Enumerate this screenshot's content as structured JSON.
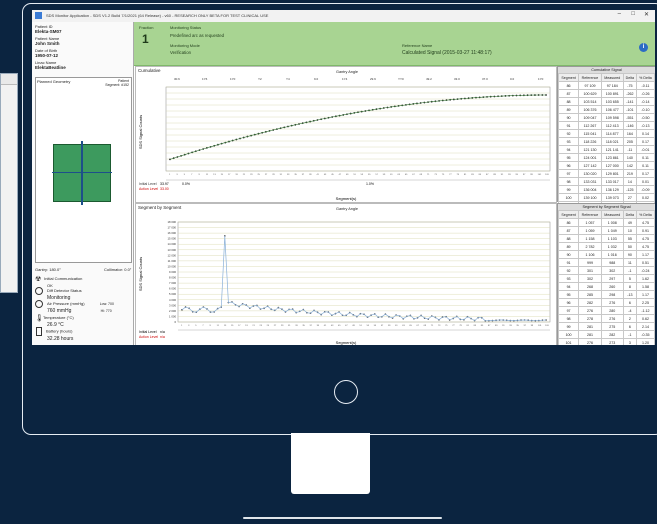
{
  "window": {
    "title": "SDS Monitor Application - SDS V1.2 Build 7/1/2021 (64 Release) - v60 - RESEARCH ONLY BETA FOR TEST CLINICAL USE",
    "min": "–",
    "max": "□",
    "close": "✕"
  },
  "patient": {
    "id_label": "Patient ID",
    "id_value": "Elekta-SM07",
    "name_label": "Patient Name",
    "name_value": "John Smith",
    "dob_label": "Date of Birth",
    "dob_value": "1950-07-12",
    "linac_label": "Linac Name",
    "linac_value": "ElektaBeatline"
  },
  "plan": {
    "title": "Planned Geometry",
    "segment_label": "Patient",
    "segment_value": "Segment: #152"
  },
  "footer": {
    "gantry": "Gantry: 180.0°",
    "collimator": "Collimator: 0.0°",
    "dose_label": "Initial Communication",
    "dose_value": "OK",
    "detector_label": "Diff Detector Status",
    "detector_value": "Monitoring",
    "pressure_label": "Air Pressure (mmHg)",
    "pressure_value": "760 mmHg",
    "temp_label": "Temperature (°C)",
    "temp_value": "26.9 °C",
    "battery_label": "Battery (hours)",
    "battery_value": "32.28 hours",
    "range1": "Low: 700",
    "range2": "Hi: 770"
  },
  "status": {
    "fraction_label": "Fraction",
    "fraction_value": "1",
    "s1_label": "Monitoring Status",
    "s1_value": "Predefined arc as requested",
    "s2_label": "Monitoring Mode",
    "s2_value": "Verification",
    "s3_label": "Reference Name",
    "s3_value": "Calculated Signal (2015-03-27 11:48:17)",
    "info": "i"
  },
  "cumulative": {
    "title": "Cumulative",
    "top_axis": "Gantry Angle",
    "ylabel": "SDS Signal Counts",
    "xlabel": "Segment(s)",
    "ticks_top": [
      "30.6",
      "1Y6",
      "1Y0",
      "Y2",
      "Y4",
      "9.0",
      "1Y4",
      "29.9",
      "YY0",
      "49.2",
      "33.0",
      "37.0",
      "0.0",
      "1Y0"
    ],
    "row1_label": "Initial Level",
    "row1_val": "33.97",
    "row2_label": "Action Level",
    "row2_val": "33.00",
    "row1_pct": "0.0%",
    "row2_pct": "1.0%"
  },
  "sbs": {
    "title": "Segment by Segment",
    "top_axis": "Gantry Angle",
    "ylabel": "SDS Signal Counts",
    "xlabel": "Segment(s)",
    "yticks": [
      "18 000",
      "17 000",
      "16 000",
      "15 000",
      "14 000",
      "13 000",
      "12 000",
      "11 000",
      "10 000",
      "9 000",
      "8 000",
      "7 000",
      "6 000",
      "5 000",
      "4 000",
      "3 000",
      "2 000",
      "1 000",
      "0"
    ],
    "row1_label": "Initial Level",
    "row1_val": "n/a",
    "row2_label": "Action Level",
    "row2_val": "n/a"
  },
  "cum_table": {
    "title": "Cumulative Signal",
    "headers": [
      "Segment",
      "Reference",
      "Measured",
      "Delta",
      "% Delta"
    ],
    "rows": [
      [
        "86",
        "97 109",
        "97 184",
        "-75",
        "-0.11"
      ],
      [
        "87",
        "100 629",
        "100 891",
        "-262",
        "-0.26"
      ],
      [
        "88",
        "103 514",
        "103 655",
        "-141",
        "-0.14"
      ],
      [
        "89",
        "106 376",
        "106 477",
        "-101",
        "-0.10"
      ],
      [
        "90",
        "109 047",
        "109 598",
        "-551",
        "-0.50"
      ],
      [
        "91",
        "112 267",
        "112 413",
        "-146",
        "-0.13"
      ],
      [
        "92",
        "115 041",
        "114 877",
        "164",
        "0.14"
      ],
      [
        "93",
        "118 226",
        "118 021",
        "205",
        "0.17"
      ],
      [
        "94",
        "121 130",
        "121 141",
        "-11",
        "-0.01"
      ],
      [
        "95",
        "124 001",
        "123 861",
        "140",
        "0.11"
      ],
      [
        "96",
        "127 142",
        "127 000",
        "142",
        "0.11"
      ],
      [
        "97",
        "130 020",
        "129 801",
        "219",
        "0.17"
      ],
      [
        "98",
        "133 031",
        "133 017",
        "14",
        "0.01"
      ],
      [
        "99",
        "136 004",
        "136 129",
        "-125",
        "-0.09"
      ],
      [
        "100",
        "139 100",
        "139 073",
        "27",
        "0.02"
      ],
      [
        "101",
        "142 151",
        "142 187",
        "-36",
        "-0.03"
      ],
      [
        "102",
        "145 042",
        "145 009",
        "33",
        "0.02"
      ]
    ]
  },
  "seg_table": {
    "title": "Segment by Segment Signal",
    "headers": [
      "Segment",
      "Reference",
      "Measured",
      "Delta",
      "% Delta"
    ],
    "rows": [
      [
        "86",
        "1 057",
        "1 008",
        "49",
        "4.75"
      ],
      [
        "87",
        "1 059",
        "1 049",
        "10",
        "0.91"
      ],
      [
        "88",
        "1 158",
        "1 103",
        "55",
        "4.75"
      ],
      [
        "89",
        "2 782",
        "1 032",
        "50",
        "4.75"
      ],
      [
        "90",
        "1 106",
        "1 016",
        "90",
        "1.17"
      ],
      [
        "91",
        "999",
        "988",
        "11",
        "0.51"
      ],
      [
        "92",
        "301",
        "302",
        "-1",
        "-0.24"
      ],
      [
        "93",
        "302",
        "297",
        "5",
        "1.62"
      ],
      [
        "94",
        "268",
        "260",
        "8",
        "1.58"
      ],
      [
        "95",
        "285",
        "298",
        "-13",
        "1.17"
      ],
      [
        "96",
        "282",
        "276",
        "6",
        "2.25"
      ],
      [
        "97",
        "276",
        "280",
        "-4",
        "-1.12"
      ],
      [
        "98",
        "278",
        "276",
        "2",
        "0.62"
      ],
      [
        "99",
        "281",
        "275",
        "6",
        "2.14"
      ],
      [
        "100",
        "281",
        "282",
        "-1",
        "-0.35"
      ],
      [
        "101",
        "276",
        "273",
        "3",
        "1.20"
      ],
      [
        "102",
        "281",
        "282",
        "-1",
        "-0.47"
      ],
      [
        "103",
        "281",
        "284",
        "-3",
        "0.84"
      ],
      [
        "104",
        "281",
        "279",
        "2",
        "0.88"
      ]
    ]
  }
}
